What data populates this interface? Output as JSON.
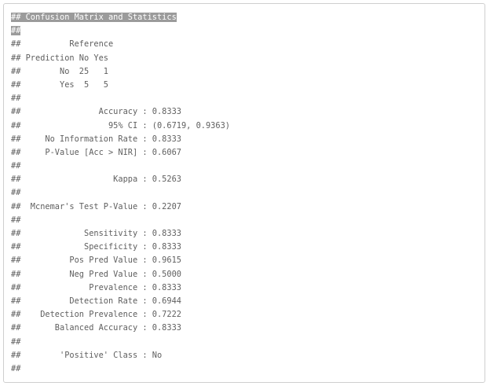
{
  "console": {
    "lines": [
      "## Confusion Matrix and Statistics",
      "##",
      "##          Reference",
      "## Prediction No Yes",
      "##        No  25   1",
      "##        Yes  5   5",
      "##",
      "##                Accuracy : 0.8333",
      "##                  95% CI : (0.6719, 0.9363)",
      "##     No Information Rate : 0.8333",
      "##     P-Value [Acc > NIR] : 0.6067",
      "##",
      "##                   Kappa : 0.5263",
      "##",
      "##  Mcnemar's Test P-Value : 0.2207",
      "##",
      "##             Sensitivity : 0.8333",
      "##             Specificity : 0.8333",
      "##          Pos Pred Value : 0.9615",
      "##          Neg Pred Value : 0.5000",
      "##              Prevalence : 0.8333",
      "##          Detection Rate : 0.6944",
      "##    Detection Prevalence : 0.7222",
      "##       Balanced Accuracy : 0.8333",
      "##",
      "##        'Positive' Class : No",
      "##"
    ]
  },
  "colors": {
    "text": "#5f5f5f",
    "selection_bg": "#9b9b9b",
    "selection_text": "#ffffff",
    "border": "#cfcfcf"
  }
}
